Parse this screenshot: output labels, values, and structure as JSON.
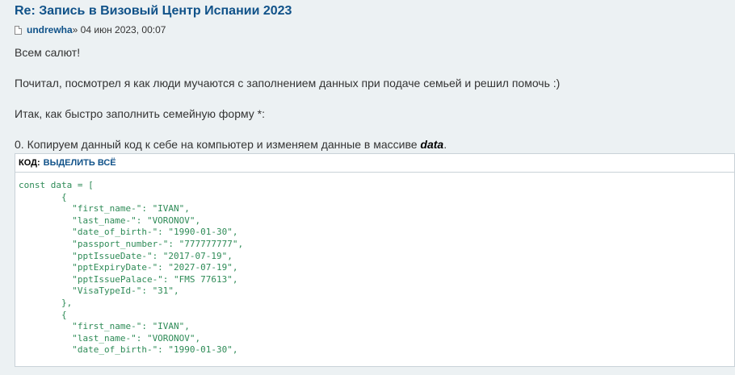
{
  "post": {
    "title": "Re: Запись в Визовый Центр Испании 2023",
    "author": "undrewha",
    "date": " » 04 июн 2023, 00:07",
    "lines": [
      "Всем салют!",
      "Почитал, посмотрел я как люди мучаются с заполнением данных при подаче семьей и решил помочь :)",
      "Итак, как быстро заполнить семейную форму *:"
    ],
    "step_text": "0. Копируем данный код к себе на компьютер и изменяем данные в массиве ",
    "step_emphasis": "data",
    "step_end": "."
  },
  "codebox": {
    "label": "КОД:",
    "select_all": "ВЫДЕЛИТЬ ВСЁ",
    "code_lines": [
      "const data = [",
      "        {",
      "          \"first_name-\": \"IVAN\",",
      "          \"last_name-\": \"VORONOV\",",
      "          \"date_of_birth-\": \"1990-01-30\",",
      "          \"passport_number-\": \"777777777\",",
      "          \"pptIssueDate-\": \"2017-07-19\",",
      "          \"pptExpiryDate-\": \"2027-07-19\",",
      "          \"pptIssuePalace-\": \"FMS 77613\",",
      "          \"VisaTypeId-\": \"31\",",
      "        },",
      "        {",
      "          \"first_name-\": \"IVAN\",",
      "          \"last_name-\": \"VORONOV\",",
      "          \"date_of_birth-\": \"1990-01-30\","
    ]
  },
  "colors": {
    "link": "#105289",
    "code": "#2e8b57",
    "background": "#ecf1f3"
  }
}
